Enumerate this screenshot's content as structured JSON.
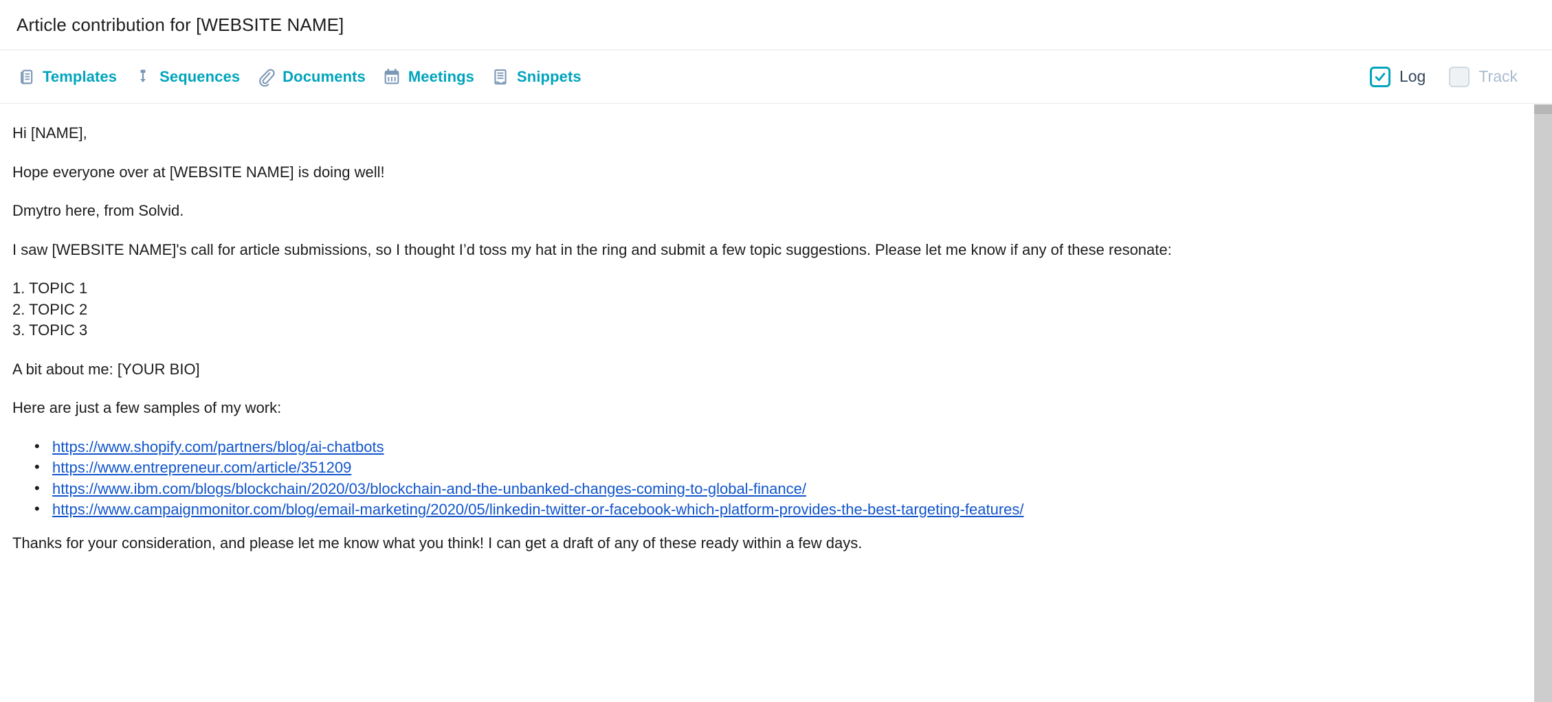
{
  "subject": {
    "text": "Article contribution for [WEBSITE NAME]"
  },
  "toolbar": {
    "items": [
      {
        "label": "Templates",
        "icon": "templates-icon"
      },
      {
        "label": "Sequences",
        "icon": "sequences-icon"
      },
      {
        "label": "Documents",
        "icon": "paperclip-icon"
      },
      {
        "label": "Meetings",
        "icon": "calendar-icon"
      },
      {
        "label": "Snippets",
        "icon": "snippet-icon"
      }
    ],
    "log": {
      "label": "Log",
      "checked": true
    },
    "track": {
      "label": "Track",
      "checked": false
    },
    "accent_color": "#00a4bd",
    "icon_color": "#7c98b6"
  },
  "message": {
    "greeting": "Hi [NAME],",
    "paragraph_1": "Hope everyone over at [WEBSITE NAME] is doing well!",
    "paragraph_2": "Dmytro here, from Solvid.",
    "paragraph_3": "I saw [WEBSITE NAME]'s call for article submissions, so I thought I’d toss my hat in the ring and submit a few topic suggestions. Please let me know if any of these resonate:",
    "topics": [
      "1. TOPIC 1",
      "2. TOPIC 2",
      "3. TOPIC 3"
    ],
    "bio_line": "A bit about me: [YOUR BIO]",
    "samples_intro": "Here are just a few samples of my work:",
    "links": [
      "https://www.shopify.com/partners/blog/ai-chatbots",
      "https://www.entrepreneur.com/article/351209",
      "https://www.ibm.com/blogs/blockchain/2020/03/blockchain-and-the-unbanked-changes-coming-to-global-finance/",
      "https://www.campaignmonitor.com/blog/email-marketing/2020/05/linkedin-twitter-or-facebook-which-platform-provides-the-best-targeting-features/"
    ],
    "link_color": "#1155cc",
    "closing": "Thanks for your consideration, and please let me know what you think! I can get a draft of any of these ready within a few days."
  }
}
